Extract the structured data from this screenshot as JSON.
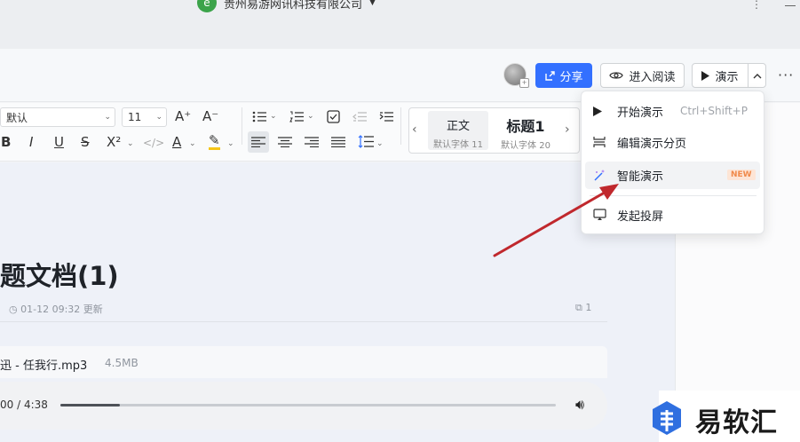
{
  "topbar": {
    "org_name": "贵州易游网讯科技有限公司",
    "org_caret": "▼",
    "more_dots": "⋮"
  },
  "header": {
    "share_label": "分享",
    "read_label": "进入阅读",
    "present_label": "演示",
    "caret": "^",
    "more": "···",
    "avatar_badge": "+"
  },
  "toolbar": {
    "font_family": "默认",
    "font_size": "11",
    "grow": "A⁺",
    "shrink": "A⁻",
    "bold": "B",
    "italic": "I",
    "underline": "U",
    "strike": "S",
    "superscript": "X²",
    "code": "</>",
    "font_color": "A",
    "highlight": "✎",
    "styles": [
      {
        "name": "正文",
        "font": "默认字体 11"
      },
      {
        "name": "标题1",
        "font": "默认字体 20"
      }
    ],
    "prev": "‹",
    "next": "›"
  },
  "document": {
    "title": "题文档(1)",
    "updated": "01-12 09:32 更新",
    "count": "1",
    "file_name": "迅 - 任我行.mp3",
    "file_size": "4.5MB",
    "time": "00 / 4:38",
    "progress": 0.12
  },
  "menu": {
    "items": [
      {
        "label": "开始演示",
        "shortcut": "Ctrl+Shift+P"
      },
      {
        "label": "编辑演示分页"
      },
      {
        "label": "智能演示",
        "badge": "NEW"
      },
      {
        "label": "发起投屏"
      }
    ]
  },
  "watermark": {
    "text": "易软汇"
  },
  "colors": {
    "primary": "#3370ff",
    "arrow": "#c0282d",
    "badge": "#f08a4b"
  }
}
